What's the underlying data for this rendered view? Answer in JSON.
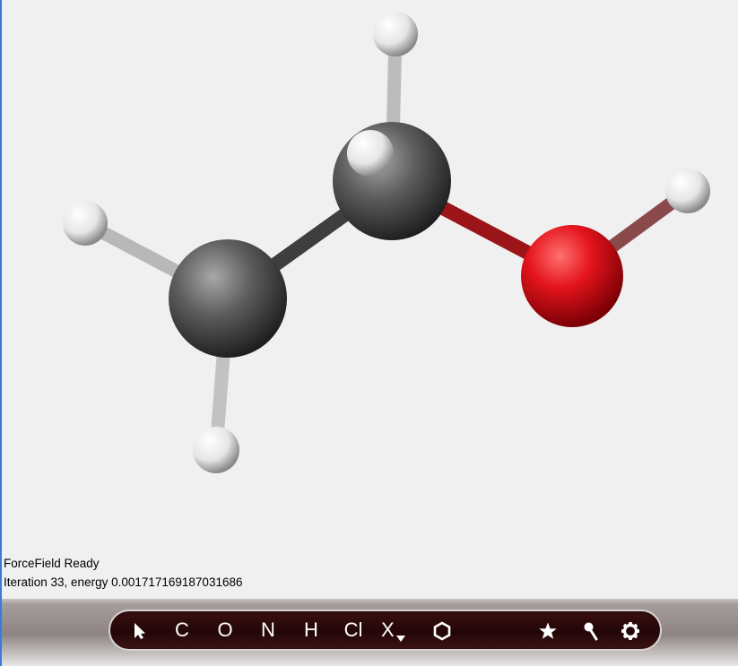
{
  "status": {
    "forcefield": "ForceField Ready",
    "iteration": "Iteration 33, energy 0.001717169187031686"
  },
  "toolbar": {
    "carbon_label": "C",
    "oxygen_label": "O",
    "nitrogen_label": "N",
    "hydrogen_label": "H",
    "chlorine_label": "Cl",
    "other_element_label": "X"
  },
  "icons": [
    "select-arrow-icon",
    "dropdown-triangle-icon",
    "ring-icon",
    "star-icon",
    "pin-icon",
    "gear-icon"
  ],
  "colors": {
    "background": "#f0f0f0",
    "carbon": "#555555",
    "hydrogen": "#f4f4f4",
    "oxygen": "#e0101a",
    "toolbar_bg": "#2a0809"
  }
}
